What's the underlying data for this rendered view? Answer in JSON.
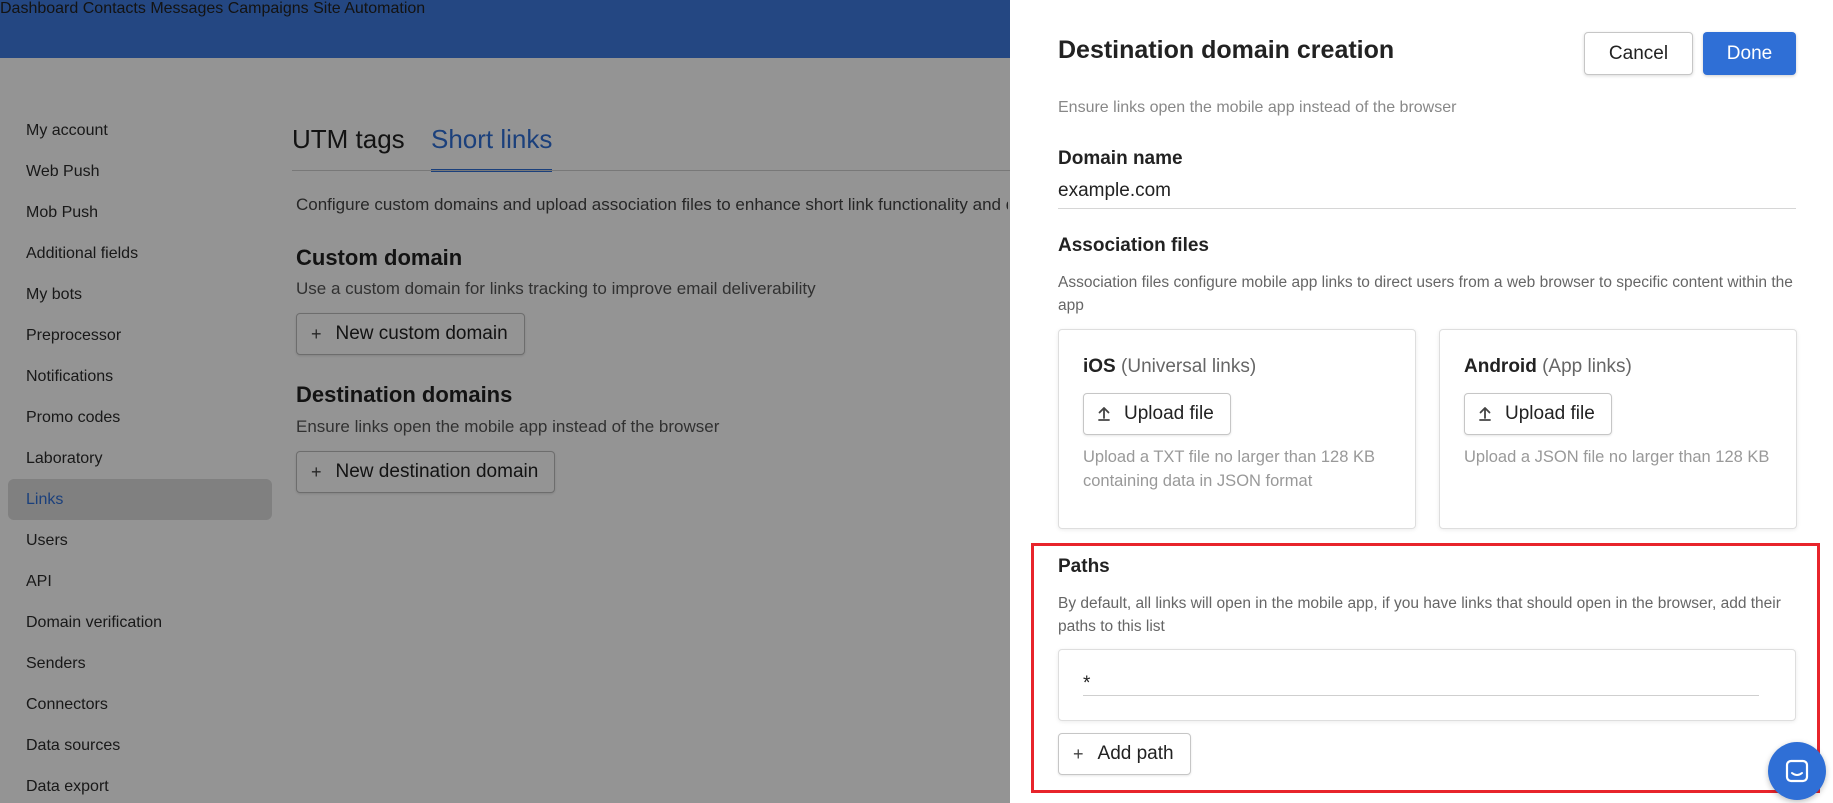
{
  "topnav": {
    "items": [
      "Dashboard",
      "Contacts",
      "Messages",
      "Campaigns",
      "Site",
      "Automation"
    ]
  },
  "sidebar": {
    "items": [
      "My account",
      "Web Push",
      "Mob Push",
      "Additional fields",
      "My bots",
      "Preprocessor",
      "Notifications",
      "Promo codes",
      "Laboratory",
      "Links",
      "Users",
      "API",
      "Domain verification",
      "Senders",
      "Connectors",
      "Data sources",
      "Data export"
    ],
    "active": "Links"
  },
  "main": {
    "tabs": [
      {
        "label": "UTM tags",
        "active": false
      },
      {
        "label": "Short links",
        "active": true
      }
    ],
    "description": "Configure custom domains and upload association files to enhance short link functionality and d",
    "custom_domain": {
      "title": "Custom domain",
      "description": "Use a custom domain for links tracking to improve email deliverability",
      "button": "New custom domain"
    },
    "destination_domains": {
      "title": "Destination domains",
      "description": "Ensure links open the mobile app instead of the browser",
      "button": "New destination domain"
    }
  },
  "drawer": {
    "title": "Destination domain creation",
    "cancel_label": "Cancel",
    "done_label": "Done",
    "subtitle": "Ensure links open the mobile app instead of the browser",
    "domain_name": {
      "label": "Domain name",
      "value": "example.com"
    },
    "association_files": {
      "label": "Association files",
      "description": "Association files configure mobile app links to direct users from a web browser to specific content within the app",
      "ios": {
        "platform": "iOS",
        "sub": "(Universal links)",
        "button": "Upload file",
        "hint": "Upload a TXT file no larger than 128 KB containing data in JSON format"
      },
      "android": {
        "platform": "Android",
        "sub": "(App links)",
        "button": "Upload file",
        "hint": "Upload a JSON file no larger than 128 KB"
      }
    },
    "paths": {
      "label": "Paths",
      "description": "By default, all links will open in the mobile app, if you have links that should open in the browser, add their paths to this list",
      "value": "*",
      "add_button": "Add path"
    }
  },
  "colors": {
    "accent": "#2f6fd6",
    "topbar": "#3f7be0",
    "highlight": "#e8242b"
  }
}
